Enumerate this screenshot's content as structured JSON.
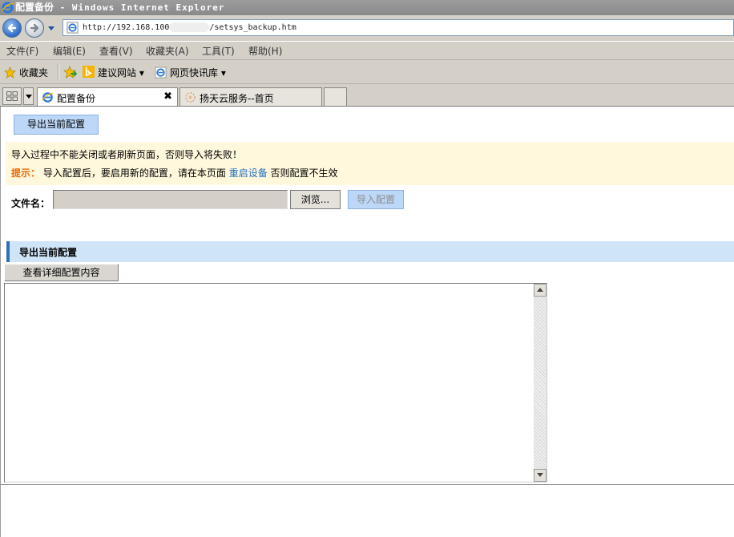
{
  "window": {
    "title": "配置备份",
    "app_suffix": " - Windows Internet Explorer"
  },
  "address": {
    "url_prefix": "http://192.168.100",
    "url_suffix": "/setsys_backup.htm"
  },
  "menu": {
    "items": [
      "文件(F)",
      "编辑(E)",
      "查看(V)",
      "收藏夹(A)",
      "工具(T)",
      "帮助(H)"
    ]
  },
  "favorites": {
    "label": "收藏夹",
    "suggested_sites": "建议网站 ▾",
    "web_slice": "网页快讯库 ▾"
  },
  "tabs": [
    {
      "label": "配置备份",
      "close": "✖"
    },
    {
      "label": "扬天云服务--首页"
    }
  ],
  "page": {
    "export_current_btn": "导出当前配置",
    "notice_line1": "导入过程中不能关闭或者刷新页面，否则导入将失败！",
    "tip_label": "提示：",
    "tip_text_before": "导入配置后，要启用新的配置，请在本页面",
    "tip_link": "重启设备",
    "tip_text_after": "否则配置不生效",
    "file_label": "文件名：",
    "browse_btn": "浏览...",
    "import_btn": "导入配置",
    "section_title": "导出当前配置",
    "view_detail_btn": "查看详细配置内容"
  }
}
